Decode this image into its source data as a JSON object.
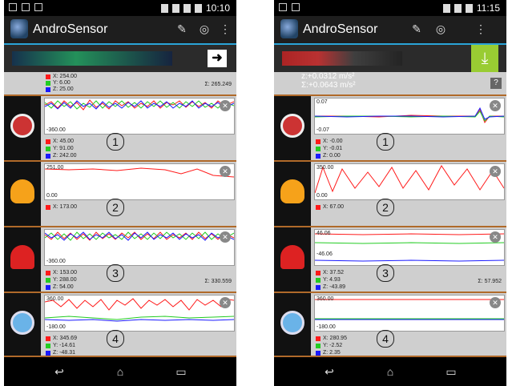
{
  "left": {
    "status_time": "10:10",
    "app_title": "AndroSensor",
    "ad_icon": "arrow-right-icon",
    "top_panel": {
      "x": "X: 254.00",
      "y": "Y: 6.00",
      "z": "Z: 25.00",
      "sigma": "Σ: 265.249"
    },
    "rows": [
      {
        "icon": "orientation-icon",
        "ytop": "",
        "ybot": "-360.00",
        "legend": [
          "X: 45.00",
          "Y: 91.00",
          "Z: 242.00"
        ],
        "sigma": "",
        "num": "1"
      },
      {
        "icon": "light-bulb-icon",
        "ytop": "251.00",
        "ybot": "0.00",
        "legend": [
          "X: 173.00"
        ],
        "sigma": "",
        "num": "2"
      },
      {
        "icon": "magnet-icon",
        "ytop": "",
        "ybot": "-360.00",
        "legend": [
          "X: 153.00",
          "Y: 288.00",
          "Z: 54.00"
        ],
        "sigma": "Σ: 330.559",
        "num": "3"
      },
      {
        "icon": "compass-icon",
        "ytop": "360.00",
        "ybot": "-180.00",
        "legend": [
          "X: 345.69",
          "Y: -14.61",
          "Z: -48.31"
        ],
        "sigma": "",
        "num": "4"
      }
    ]
  },
  "right": {
    "status_time": "11:15",
    "app_title": "AndroSensor",
    "ad_icon": "download-icon",
    "top_panel": {
      "line1": "z:+0.0312 m/s²",
      "line2": "Σ:+0.0643 m/s²",
      "help": "?"
    },
    "rows": [
      {
        "icon": "orientation-icon",
        "ytop": "0.07",
        "ybot": "-0.07",
        "legend": [
          "X: -0.00",
          "Y: -0.01",
          "Z: 0.00"
        ],
        "sigma": "",
        "num": "1"
      },
      {
        "icon": "light-bulb-icon",
        "ytop": "350.00",
        "ybot": "0.00",
        "legend": [
          "X: 67.00"
        ],
        "sigma": "",
        "num": "2"
      },
      {
        "icon": "magnet-icon",
        "ytop": "46.06",
        "ybot": "-46.06",
        "legend": [
          "X: 37.52",
          "Y: 4.93",
          "Z: -43.89"
        ],
        "sigma": "Σ: 57.952",
        "num": "3"
      },
      {
        "icon": "compass-icon",
        "ytop": "360.00",
        "ybot": "-180.00",
        "legend": [
          "X: 280.95",
          "Y: -2.52",
          "Z: 2.35"
        ],
        "sigma": "",
        "num": "4"
      }
    ]
  },
  "colors": {
    "x": "#ff1a1a",
    "y": "#22cc22",
    "z": "#1a1aff",
    "accent": "#2aa4d8",
    "divider": "#b06a2a"
  }
}
